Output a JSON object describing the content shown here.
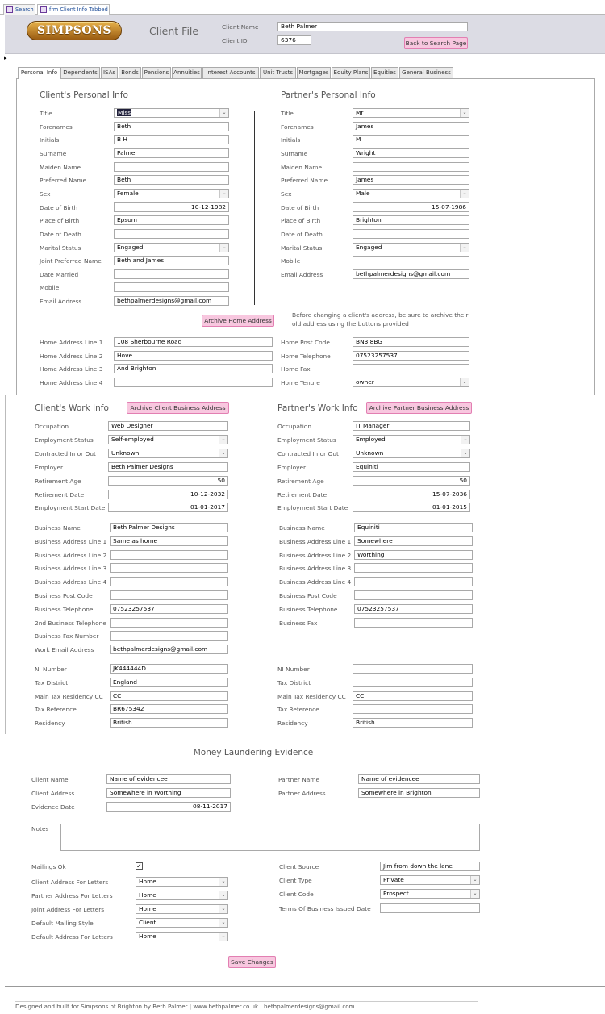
{
  "doc_tabs": [
    {
      "label": "Search"
    },
    {
      "label": "frm Client Info Tabbed"
    }
  ],
  "header": {
    "logo_text": "SIMPSONS",
    "title": "Client File",
    "client_name_label": "Client Name",
    "client_name": "Beth Palmer",
    "client_id_label": "Client ID",
    "client_id": "6376",
    "back_button": "Back to Search Page"
  },
  "tabs": [
    {
      "label": "Personal Info"
    },
    {
      "label": "Dependents"
    },
    {
      "label": "ISAs"
    },
    {
      "label": "Bonds"
    },
    {
      "label": "Pensions"
    },
    {
      "label": "Annuities"
    },
    {
      "label": "Interest Accounts"
    },
    {
      "label": "Unit Trusts"
    },
    {
      "label": "Mortgages"
    },
    {
      "label": "Equity Plans"
    },
    {
      "label": "Equities"
    },
    {
      "label": "General Business"
    }
  ],
  "client_personal": {
    "heading": "Client's Personal Info",
    "fields": [
      {
        "label": "Title",
        "value": "Miss",
        "type": "dropdown"
      },
      {
        "label": "Forenames",
        "value": "Beth"
      },
      {
        "label": "Initials",
        "value": "B H"
      },
      {
        "label": "Surname",
        "value": "Palmer"
      },
      {
        "label": "Maiden Name",
        "value": ""
      },
      {
        "label": "Preferred Name",
        "value": "Beth"
      },
      {
        "label": "Sex",
        "value": "Female",
        "type": "dropdown"
      },
      {
        "label": "Date of Birth",
        "value": "10-12-1982",
        "align": "right"
      },
      {
        "label": "Place of Birth",
        "value": "Epsom"
      },
      {
        "label": "Date of Death",
        "value": ""
      },
      {
        "label": "Marital Status",
        "value": "Engaged",
        "type": "dropdown"
      },
      {
        "label": "Joint Preferred Name",
        "value": "Beth and James"
      },
      {
        "label": "Date Married",
        "value": ""
      },
      {
        "label": "Mobile",
        "value": ""
      },
      {
        "label": "Email Address",
        "value": "bethpalmerdesigns@gmail.com"
      }
    ]
  },
  "partner_personal": {
    "heading": "Partner's Personal Info",
    "fields": [
      {
        "label": "Title",
        "value": "Mr",
        "type": "dropdown"
      },
      {
        "label": "Forenames",
        "value": "James"
      },
      {
        "label": "Initials",
        "value": "M"
      },
      {
        "label": "Surname",
        "value": "Wright"
      },
      {
        "label": "Maiden Name",
        "value": ""
      },
      {
        "label": "Preferred Name",
        "value": "James"
      },
      {
        "label": "Sex",
        "value": "Male",
        "type": "dropdown"
      },
      {
        "label": "Date of Birth",
        "value": "15-07-1986",
        "align": "right"
      },
      {
        "label": "Place of Birth",
        "value": "Brighton"
      },
      {
        "label": "Date of Death",
        "value": ""
      },
      {
        "label": "Marital Status",
        "value": "Engaged",
        "type": "dropdown"
      },
      {
        "label": "Mobile",
        "value": ""
      },
      {
        "label": "Email Address",
        "value": "bethpalmerdesigns@gmail.com"
      }
    ]
  },
  "archive_home_button": "Archive Home Address",
  "archive_note": "Before changing a client's address, be sure to archive their old address using the buttons provided",
  "home_left": [
    {
      "label": "Home Address Line 1",
      "value": "108 Sherbourne Road"
    },
    {
      "label": "Home Address Line 2",
      "value": "Hove"
    },
    {
      "label": "Home Address Line 3",
      "value": "And Brighton"
    },
    {
      "label": "Home Address Line 4",
      "value": ""
    }
  ],
  "home_right": [
    {
      "label": "Home Post Code",
      "value": "BN3 8BG"
    },
    {
      "label": "Home Telephone",
      "value": "07523257537"
    },
    {
      "label": "Home Fax",
      "value": ""
    },
    {
      "label": "Home Tenure",
      "value": "owner",
      "type": "dropdown"
    }
  ],
  "client_work": {
    "heading": "Client's Work Info",
    "archive_button": "Archive Client Business Address",
    "fields": [
      {
        "label": "Occupation",
        "value": "Web Designer"
      },
      {
        "label": "Employment Status",
        "value": "Self-employed",
        "type": "dropdown"
      },
      {
        "label": "Contracted In or Out",
        "value": "Unknown",
        "type": "dropdown"
      },
      {
        "label": "Employer",
        "value": "Beth Palmer Designs"
      },
      {
        "label": "Retirement Age",
        "value": "50",
        "align": "right"
      },
      {
        "label": "Retirement Date",
        "value": "10-12-2032",
        "align": "right"
      },
      {
        "label": "Employment Start Date",
        "value": "01-01-2017",
        "align": "right"
      }
    ],
    "business": [
      {
        "label": "Business Name",
        "value": "Beth Palmer Designs"
      },
      {
        "label": "Business Address Line 1",
        "value": "Same as home"
      },
      {
        "label": "Business Address Line 2",
        "value": ""
      },
      {
        "label": "Business Address Line 3",
        "value": ""
      },
      {
        "label": "Business Address Line 4",
        "value": ""
      },
      {
        "label": "Business Post Code",
        "value": ""
      },
      {
        "label": "Business Telephone",
        "value": "07523257537"
      },
      {
        "label": "2nd Business Telephone",
        "value": ""
      },
      {
        "label": "Business Fax Number",
        "value": ""
      },
      {
        "label": "Work Email Address",
        "value": "bethpalmerdesigns@gmail.com"
      }
    ],
    "tax": [
      {
        "label": "NI Number",
        "value": "JK444444D"
      },
      {
        "label": "Tax District",
        "value": "England"
      },
      {
        "label": "Main Tax Residency CC",
        "value": "CC"
      },
      {
        "label": "Tax Reference",
        "value": "BR675342"
      },
      {
        "label": "Residency",
        "value": "British"
      }
    ]
  },
  "partner_work": {
    "heading": "Partner's Work Info",
    "archive_button": "Archive Partner Business Address",
    "fields": [
      {
        "label": "Occupation",
        "value": "IT Manager"
      },
      {
        "label": "Employment Status",
        "value": "Employed",
        "type": "dropdown"
      },
      {
        "label": "Contracted In or Out",
        "value": "Unknown",
        "type": "dropdown"
      },
      {
        "label": "Employer",
        "value": "Equiniti"
      },
      {
        "label": "Retirement Age",
        "value": "50",
        "align": "right"
      },
      {
        "label": "Retirement Date",
        "value": "15-07-2036",
        "align": "right"
      },
      {
        "label": "Employment Start Date",
        "value": "01-01-2015",
        "align": "right"
      }
    ],
    "business": [
      {
        "label": "Business Name",
        "value": "Equiniti"
      },
      {
        "label": "Business Address Line 1",
        "value": "Somewhere"
      },
      {
        "label": "Business Address Line 2",
        "value": "Worthing"
      },
      {
        "label": "Business Address Line 3",
        "value": ""
      },
      {
        "label": "Business Address Line 4",
        "value": ""
      },
      {
        "label": "Business Post Code",
        "value": ""
      },
      {
        "label": "Business Telephone",
        "value": "07523257537"
      },
      {
        "label": "Business Fax",
        "value": ""
      }
    ],
    "tax": [
      {
        "label": "NI Number",
        "value": ""
      },
      {
        "label": "Tax District",
        "value": ""
      },
      {
        "label": "Main Tax Residency CC",
        "value": "CC"
      },
      {
        "label": "Tax Reference",
        "value": ""
      },
      {
        "label": "Residency",
        "value": "British"
      }
    ]
  },
  "money_laundering": {
    "heading": "Money Laundering Evidence",
    "left": [
      {
        "label": "Client Name",
        "value": "Name of evidencee"
      },
      {
        "label": "Client Address",
        "value": "Somewhere in Worthing"
      },
      {
        "label": "Evidence Date",
        "value": "08-11-2017",
        "align": "right"
      }
    ],
    "right": [
      {
        "label": "Partner Name",
        "value": "Name of evidencee"
      },
      {
        "label": "Partner Address",
        "value": "Somewhere in Brighton"
      }
    ],
    "notes_label": "Notes",
    "notes_value": ""
  },
  "mailing": {
    "mailings_ok_label": "Mailings Ok",
    "mailings_ok_mark": "✓",
    "left": [
      {
        "label": "Client Address For Letters",
        "value": "Home"
      },
      {
        "label": "Partner Address For Letters",
        "value": "Home"
      },
      {
        "label": "Joint Address For Letters",
        "value": "Home"
      },
      {
        "label": "Default Mailing Style",
        "value": "Client"
      },
      {
        "label": "Default Address For Letters",
        "value": "Home"
      }
    ],
    "right": [
      {
        "label": "Client Source",
        "value": "Jim from down the lane"
      },
      {
        "label": "Client Type",
        "value": "Private",
        "type": "dropdown"
      },
      {
        "label": "Client Code",
        "value": "Prospect",
        "type": "dropdown"
      },
      {
        "label": "Terms Of Business Issued Date",
        "value": ""
      }
    ]
  },
  "save_button": "Save Changes",
  "footer": "Designed and built for Simpsons of Brighton by Beth Palmer  |  www.bethpalmer.co.uk  |  bethpalmerdesigns@gmail.com",
  "dropdown_glyph": "⌄",
  "record_selector_glyph": "▸"
}
